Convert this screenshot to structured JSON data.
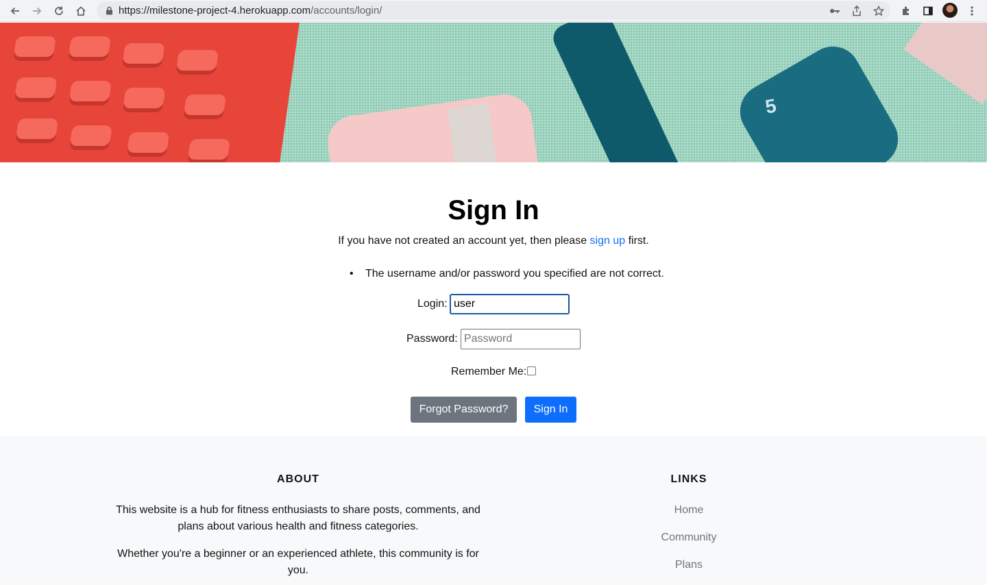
{
  "browser": {
    "url_host": "https://milestone-project-4.herokuapp.com",
    "url_path": "/accounts/login/"
  },
  "hero": {
    "dumbbell_number": "5"
  },
  "main": {
    "title": "Sign In",
    "intro_prefix": "If you have not created an account yet, then please ",
    "intro_link": "sign up",
    "intro_suffix": " first.",
    "error_message": "The username and/or password you specified are not correct.",
    "login_label": "Login:",
    "login_value": "user",
    "password_label": "Password:",
    "password_placeholder": "Password",
    "remember_label": "Remember Me:",
    "forgot_button": "Forgot Password?",
    "signin_button": "Sign In"
  },
  "footer": {
    "about_heading": "ABOUT",
    "about_p1": "This website is a hub for fitness enthusiasts to share posts, comments, and plans about various health and fitness categories.",
    "about_p2": "Whether you're a beginner or an experienced athlete, this community is for you.",
    "links_heading": "LINKS",
    "links": [
      "Home",
      "Community",
      "Plans"
    ]
  },
  "colors": {
    "primary": "#0d6efd",
    "secondary": "#6c757d",
    "footer_bg": "#f8f9fa"
  }
}
